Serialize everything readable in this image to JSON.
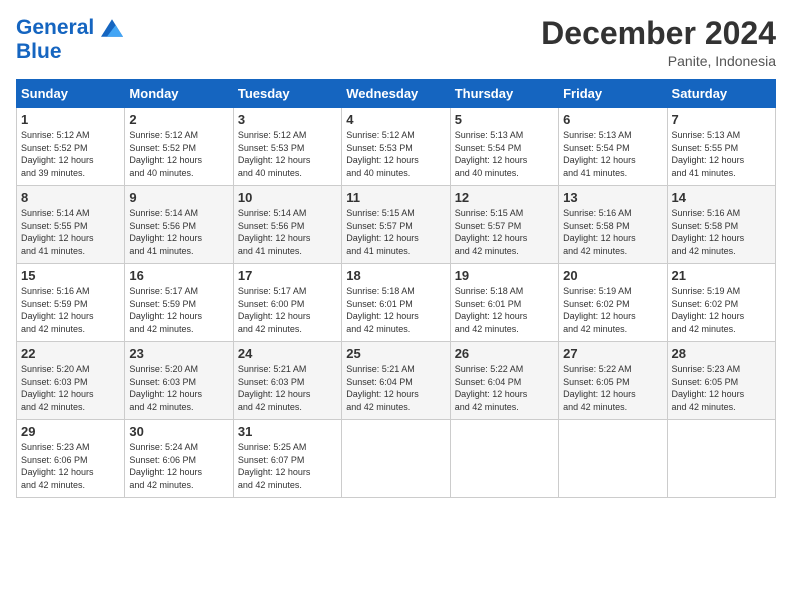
{
  "header": {
    "logo_line1": "General",
    "logo_line2": "Blue",
    "title": "December 2024",
    "location": "Panite, Indonesia"
  },
  "weekdays": [
    "Sunday",
    "Monday",
    "Tuesday",
    "Wednesday",
    "Thursday",
    "Friday",
    "Saturday"
  ],
  "weeks": [
    [
      {
        "day": "1",
        "sunrise": "5:12 AM",
        "sunset": "5:52 PM",
        "daylight": "12 hours and 39 minutes."
      },
      {
        "day": "2",
        "sunrise": "5:12 AM",
        "sunset": "5:52 PM",
        "daylight": "12 hours and 40 minutes."
      },
      {
        "day": "3",
        "sunrise": "5:12 AM",
        "sunset": "5:53 PM",
        "daylight": "12 hours and 40 minutes."
      },
      {
        "day": "4",
        "sunrise": "5:12 AM",
        "sunset": "5:53 PM",
        "daylight": "12 hours and 40 minutes."
      },
      {
        "day": "5",
        "sunrise": "5:13 AM",
        "sunset": "5:54 PM",
        "daylight": "12 hours and 40 minutes."
      },
      {
        "day": "6",
        "sunrise": "5:13 AM",
        "sunset": "5:54 PM",
        "daylight": "12 hours and 41 minutes."
      },
      {
        "day": "7",
        "sunrise": "5:13 AM",
        "sunset": "5:55 PM",
        "daylight": "12 hours and 41 minutes."
      }
    ],
    [
      {
        "day": "8",
        "sunrise": "5:14 AM",
        "sunset": "5:55 PM",
        "daylight": "12 hours and 41 minutes."
      },
      {
        "day": "9",
        "sunrise": "5:14 AM",
        "sunset": "5:56 PM",
        "daylight": "12 hours and 41 minutes."
      },
      {
        "day": "10",
        "sunrise": "5:14 AM",
        "sunset": "5:56 PM",
        "daylight": "12 hours and 41 minutes."
      },
      {
        "day": "11",
        "sunrise": "5:15 AM",
        "sunset": "5:57 PM",
        "daylight": "12 hours and 41 minutes."
      },
      {
        "day": "12",
        "sunrise": "5:15 AM",
        "sunset": "5:57 PM",
        "daylight": "12 hours and 42 minutes."
      },
      {
        "day": "13",
        "sunrise": "5:16 AM",
        "sunset": "5:58 PM",
        "daylight": "12 hours and 42 minutes."
      },
      {
        "day": "14",
        "sunrise": "5:16 AM",
        "sunset": "5:58 PM",
        "daylight": "12 hours and 42 minutes."
      }
    ],
    [
      {
        "day": "15",
        "sunrise": "5:16 AM",
        "sunset": "5:59 PM",
        "daylight": "12 hours and 42 minutes."
      },
      {
        "day": "16",
        "sunrise": "5:17 AM",
        "sunset": "5:59 PM",
        "daylight": "12 hours and 42 minutes."
      },
      {
        "day": "17",
        "sunrise": "5:17 AM",
        "sunset": "6:00 PM",
        "daylight": "12 hours and 42 minutes."
      },
      {
        "day": "18",
        "sunrise": "5:18 AM",
        "sunset": "6:01 PM",
        "daylight": "12 hours and 42 minutes."
      },
      {
        "day": "19",
        "sunrise": "5:18 AM",
        "sunset": "6:01 PM",
        "daylight": "12 hours and 42 minutes."
      },
      {
        "day": "20",
        "sunrise": "5:19 AM",
        "sunset": "6:02 PM",
        "daylight": "12 hours and 42 minutes."
      },
      {
        "day": "21",
        "sunrise": "5:19 AM",
        "sunset": "6:02 PM",
        "daylight": "12 hours and 42 minutes."
      }
    ],
    [
      {
        "day": "22",
        "sunrise": "5:20 AM",
        "sunset": "6:03 PM",
        "daylight": "12 hours and 42 minutes."
      },
      {
        "day": "23",
        "sunrise": "5:20 AM",
        "sunset": "6:03 PM",
        "daylight": "12 hours and 42 minutes."
      },
      {
        "day": "24",
        "sunrise": "5:21 AM",
        "sunset": "6:03 PM",
        "daylight": "12 hours and 42 minutes."
      },
      {
        "day": "25",
        "sunrise": "5:21 AM",
        "sunset": "6:04 PM",
        "daylight": "12 hours and 42 minutes."
      },
      {
        "day": "26",
        "sunrise": "5:22 AM",
        "sunset": "6:04 PM",
        "daylight": "12 hours and 42 minutes."
      },
      {
        "day": "27",
        "sunrise": "5:22 AM",
        "sunset": "6:05 PM",
        "daylight": "12 hours and 42 minutes."
      },
      {
        "day": "28",
        "sunrise": "5:23 AM",
        "sunset": "6:05 PM",
        "daylight": "12 hours and 42 minutes."
      }
    ],
    [
      {
        "day": "29",
        "sunrise": "5:23 AM",
        "sunset": "6:06 PM",
        "daylight": "12 hours and 42 minutes."
      },
      {
        "day": "30",
        "sunrise": "5:24 AM",
        "sunset": "6:06 PM",
        "daylight": "12 hours and 42 minutes."
      },
      {
        "day": "31",
        "sunrise": "5:25 AM",
        "sunset": "6:07 PM",
        "daylight": "12 hours and 42 minutes."
      },
      null,
      null,
      null,
      null
    ]
  ],
  "cell_labels": {
    "sunrise": "Sunrise:",
    "sunset": "Sunset:",
    "daylight": "Daylight:"
  }
}
